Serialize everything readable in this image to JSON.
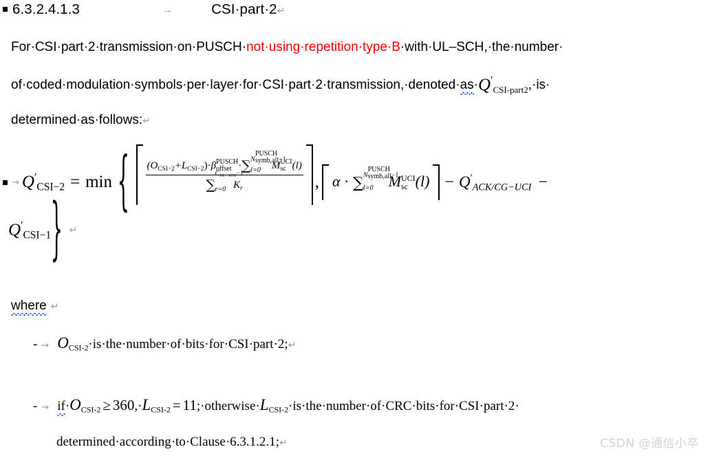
{
  "document": {
    "heading": {
      "bullet": "square-bullet",
      "number": "6.3.2.4.1.3",
      "tab_arrow": "→",
      "title": "CSI·part·2",
      "pilcrow": "↵"
    },
    "paragraph": {
      "line1_part1": "For·CSI·part·2·transmission·on·PUSCH·",
      "line1_red": "not·using·repetition·type·B",
      "line1_part2": "·with·UL–SCH,·the·number·",
      "line2_part1": "of·coded·modulation·symbols·per·layer·for·CSI·part·2·transmission,·denoted·",
      "line2_misspelled": "as",
      "line2_part2": "·",
      "line2_math_Q": "Q",
      "line2_math_prime": "′",
      "line2_math_sub": "CSI-part2",
      "line2_part3": ",·is·",
      "line3": "determined·as·follows:",
      "line3_pilcrow": "↵"
    },
    "formula": {
      "bullet": "square-bullet",
      "tab_arrow": "→",
      "lhs_var": "Q",
      "lhs_prime": "′",
      "lhs_sub": "CSI−2",
      "equals": "=",
      "min_op": "min",
      "brace_open": "{",
      "brace_close": "}",
      "term1": {
        "numerator_paren": "(O",
        "num_sub1": "CSI−2",
        "num_plus": "+L",
        "num_sub2": "CSI−2",
        "num_close": ")·",
        "beta": "β",
        "beta_sup": "PUSCH",
        "beta_sub": "offset",
        "dot": "·",
        "sigma": "∑",
        "sum_sup_top": "N",
        "sum_sup_n_sup": "PUSCH",
        "sum_sup_n_sub": "symb,all",
        "sum_sup_minus1": "−1",
        "sum_sub": "l=0",
        "M": "M",
        "M_sup": "UCI",
        "M_sub": "sc",
        "M_arg": "(l)",
        "denominator_sigma": "∑",
        "den_sup_C": "C",
        "den_sup_ulsch": "UL−SCH",
        "den_sup_minus1": "−1",
        "den_sub": "r=0",
        "den_K": "K",
        "den_K_sub": "r"
      },
      "comma": ",",
      "term2": {
        "alpha": "α",
        "cdot": "·",
        "sigma": "∑",
        "sum_sup_top": "N",
        "sum_sup_n_sup": "PUSCH",
        "sum_sup_n_sub": "symb,all",
        "sum_sup_minus1": "−1",
        "sum_sub": "l=0",
        "M": "M",
        "M_sup": "UCI",
        "M_sub": "sc",
        "M_arg": "(l)",
        "minus1": "−",
        "Q_ack": "Q",
        "Q_ack_prime": "′",
        "Q_ack_sub": "ACK/CG−UCI",
        "minus2": "−"
      },
      "continuation": {
        "Q": "Q",
        "prime": "′",
        "sub": "CSI−1",
        "brace_close": "}",
        "pilcrow": "↵"
      }
    },
    "where": {
      "label": "where",
      "pilcrow": "↵"
    },
    "bullets": [
      {
        "dash": "-",
        "tab_arrow": "→",
        "var": "O",
        "var_sub": "CSI-2",
        "text": "·is·the·number·of·bits·for·CSI·part·2;",
        "pilcrow": "↵"
      },
      {
        "dash": "-",
        "tab_arrow": "→",
        "if_word": "if",
        "sep1": "·",
        "var1": "O",
        "var1_sub": "CSI-2",
        "rel1": "≥",
        "num1": "360",
        "comma": ",·",
        "var2": "L",
        "var2_sub": "CSI-2",
        "rel2": "=",
        "num2": "11",
        "semi": ";·otherwise·",
        "var3": "L",
        "var3_sub": "CSI-2",
        "text_end": "·is·the·number·of·CRC·bits·for·CSI·part·2·"
      },
      {
        "text": "determined·according·to·Clause·6.3.1.2.1;",
        "pilcrow": "↵"
      }
    ],
    "watermark": "CSDN @通信小卒"
  },
  "colors": {
    "red_highlight": "#ff0000",
    "spellcheck_underline": "#1450d8",
    "watermark": "#d2d2d2",
    "tab_arrow": "#9a9a9a"
  }
}
